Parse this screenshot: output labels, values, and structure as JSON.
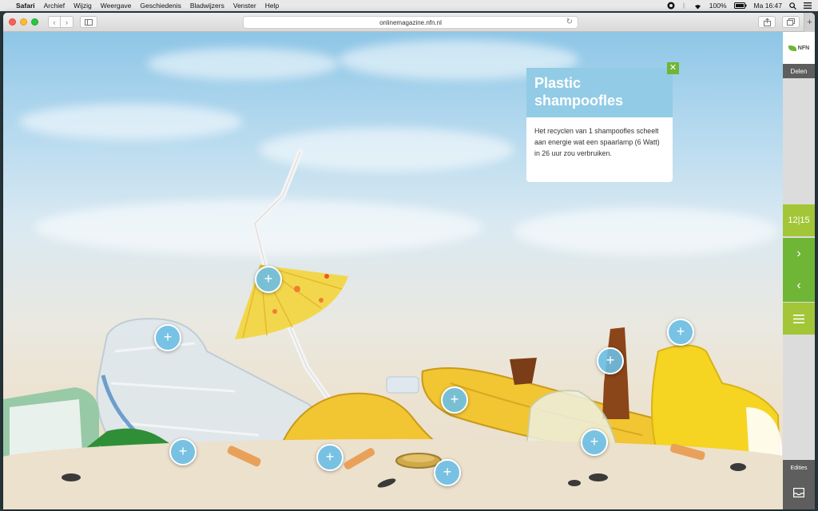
{
  "menubar": {
    "items": [
      "Safari",
      "Archief",
      "Wijzig",
      "Weergave",
      "Geschiedenis",
      "Bladwijzers",
      "Venster",
      "Help"
    ],
    "battery": "100%",
    "clock": "Ma 16:47"
  },
  "browser": {
    "url": "onlinemagazine.nfn.nl"
  },
  "popup": {
    "title": "Plastic shampoofles",
    "body": "Het recyclen van 1 shampoofles scheelt aan energie wat een spaarlamp (6 Watt) in 26 uur zou verbruiken.",
    "close": "✕"
  },
  "sidebar": {
    "logo_text": "NFN",
    "share_label": "Delen",
    "page_indicator": "12|15",
    "editions_label": "Edities"
  },
  "colors": {
    "accent_green": "#6fb637",
    "lime": "#a2c637",
    "popup_blue": "#92cbe6",
    "hotspot_blue": "#6cbee4"
  }
}
